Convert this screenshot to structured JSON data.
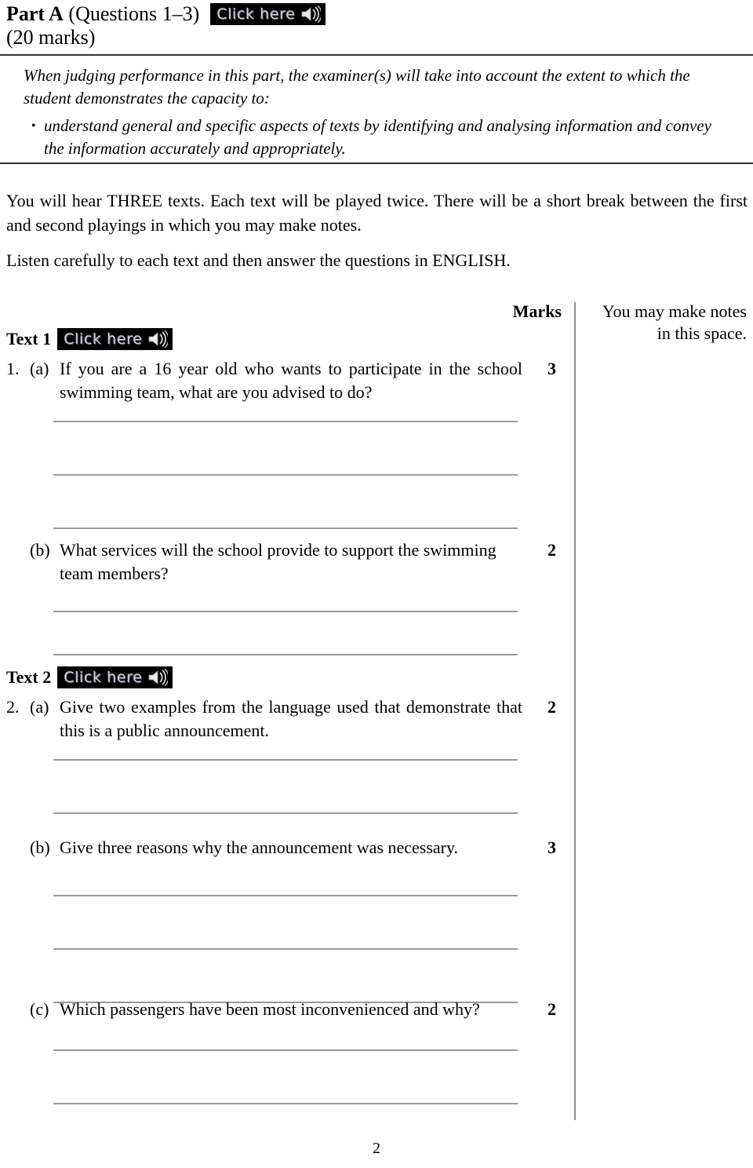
{
  "header": {
    "part_label": "Part A",
    "part_questions": "(Questions 1–3)",
    "marks_line": "(20 marks)"
  },
  "audio_button": {
    "label": "Click here",
    "icon": "speaker-icon"
  },
  "instructions": {
    "intro": "When judging performance in this part, the examiner(s) will take into account the extent to which the student demonstrates the capacity to:",
    "bullet_marker": "•",
    "bullet": "understand general and specific aspects of texts by identifying and analysing information and convey the information accurately and appropriately."
  },
  "body": {
    "paragraph_1": "You will hear THREE texts. Each text will be played twice. There will be a short break between the first and second playings in which you may make notes.",
    "paragraph_2": "Listen carefully to each text and then answer the questions in ENGLISH."
  },
  "columns": {
    "marks_header": "Marks",
    "notes_header_line1": "You may make notes",
    "notes_header_line2": "in this space."
  },
  "texts": [
    {
      "label": "Text 1"
    },
    {
      "label": "Text 2"
    }
  ],
  "questions": [
    {
      "number": "1.",
      "letter": "(a)",
      "text": "If you are a 16 year old who wants to participate in the school swimming team, what are you advised to do?",
      "marks": "3"
    },
    {
      "number": "",
      "letter": "(b)",
      "text": "What services will the school provide to support the swimming team members?",
      "marks": "2"
    },
    {
      "number": "2.",
      "letter": "(a)",
      "text": "Give two examples from the language used that demonstrate that this is a public announcement.",
      "marks": "2"
    },
    {
      "number": "",
      "letter": "(b)",
      "text": "Give three reasons why the announcement was necessary.",
      "marks": "3"
    },
    {
      "number": "",
      "letter": "(c)",
      "text": "Which passengers have been most inconvenienced and why?",
      "marks": "2"
    }
  ],
  "footer": {
    "page_number": "2"
  }
}
